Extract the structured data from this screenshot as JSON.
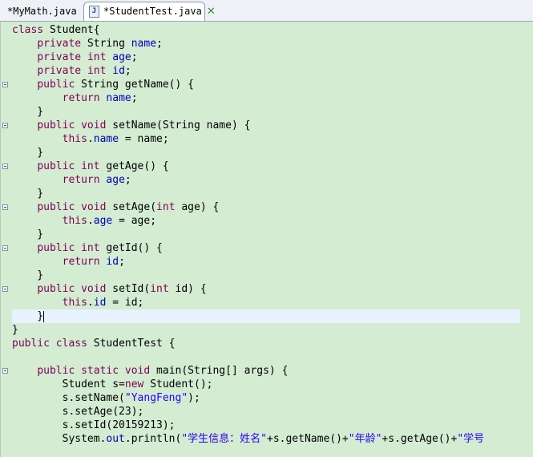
{
  "tabs": [
    {
      "label": "*MyMath.java",
      "active": false
    },
    {
      "label": "*StudentTest.java",
      "active": true
    }
  ],
  "colors": {
    "editor_bg": "#d3ecd2",
    "keyword": "#7f0055",
    "field": "#0000c0",
    "string": "#2a00ff",
    "current_line": "#e8f2fe"
  },
  "code_lines": [
    [
      [
        "kw",
        "class"
      ],
      [
        "p",
        " Student{"
      ]
    ],
    [
      [
        "p",
        "    "
      ],
      [
        "kw",
        "private"
      ],
      [
        "p",
        " String "
      ],
      [
        "fd",
        "name"
      ],
      [
        "p",
        ";"
      ]
    ],
    [
      [
        "p",
        "    "
      ],
      [
        "kw",
        "private"
      ],
      [
        "p",
        " "
      ],
      [
        "kw",
        "int"
      ],
      [
        "p",
        " "
      ],
      [
        "fd",
        "age"
      ],
      [
        "p",
        ";"
      ]
    ],
    [
      [
        "p",
        "    "
      ],
      [
        "kw",
        "private"
      ],
      [
        "p",
        " "
      ],
      [
        "kw",
        "int"
      ],
      [
        "p",
        " "
      ],
      [
        "fd",
        "id"
      ],
      [
        "p",
        ";"
      ]
    ],
    [
      [
        "p",
        "    "
      ],
      [
        "kw",
        "public"
      ],
      [
        "p",
        " String getName() {"
      ]
    ],
    [
      [
        "p",
        "        "
      ],
      [
        "kw",
        "return"
      ],
      [
        "p",
        " "
      ],
      [
        "fd",
        "name"
      ],
      [
        "p",
        ";"
      ]
    ],
    [
      [
        "p",
        "    }"
      ]
    ],
    [
      [
        "p",
        "    "
      ],
      [
        "kw",
        "public"
      ],
      [
        "p",
        " "
      ],
      [
        "kw",
        "void"
      ],
      [
        "p",
        " setName(String name) {"
      ]
    ],
    [
      [
        "p",
        "        "
      ],
      [
        "kw",
        "this"
      ],
      [
        "p",
        "."
      ],
      [
        "fd",
        "name"
      ],
      [
        "p",
        " = name;"
      ]
    ],
    [
      [
        "p",
        "    }"
      ]
    ],
    [
      [
        "p",
        "    "
      ],
      [
        "kw",
        "public"
      ],
      [
        "p",
        " "
      ],
      [
        "kw",
        "int"
      ],
      [
        "p",
        " getAge() {"
      ]
    ],
    [
      [
        "p",
        "        "
      ],
      [
        "kw",
        "return"
      ],
      [
        "p",
        " "
      ],
      [
        "fd",
        "age"
      ],
      [
        "p",
        ";"
      ]
    ],
    [
      [
        "p",
        "    }"
      ]
    ],
    [
      [
        "p",
        "    "
      ],
      [
        "kw",
        "public"
      ],
      [
        "p",
        " "
      ],
      [
        "kw",
        "void"
      ],
      [
        "p",
        " setAge("
      ],
      [
        "kw",
        "int"
      ],
      [
        "p",
        " age) {"
      ]
    ],
    [
      [
        "p",
        "        "
      ],
      [
        "kw",
        "this"
      ],
      [
        "p",
        "."
      ],
      [
        "fd",
        "age"
      ],
      [
        "p",
        " = age;"
      ]
    ],
    [
      [
        "p",
        "    }"
      ]
    ],
    [
      [
        "p",
        "    "
      ],
      [
        "kw",
        "public"
      ],
      [
        "p",
        " "
      ],
      [
        "kw",
        "int"
      ],
      [
        "p",
        " getId() {"
      ]
    ],
    [
      [
        "p",
        "        "
      ],
      [
        "kw",
        "return"
      ],
      [
        "p",
        " "
      ],
      [
        "fd",
        "id"
      ],
      [
        "p",
        ";"
      ]
    ],
    [
      [
        "p",
        "    }"
      ]
    ],
    [
      [
        "p",
        "    "
      ],
      [
        "kw",
        "public"
      ],
      [
        "p",
        " "
      ],
      [
        "kw",
        "void"
      ],
      [
        "p",
        " setId("
      ],
      [
        "kw",
        "int"
      ],
      [
        "p",
        " id) {"
      ]
    ],
    [
      [
        "p",
        "        "
      ],
      [
        "kw",
        "this"
      ],
      [
        "p",
        "."
      ],
      [
        "fd",
        "id"
      ],
      [
        "p",
        " = id;"
      ]
    ],
    [
      [
        "p",
        "    }"
      ]
    ],
    [
      [
        "p",
        "}"
      ]
    ],
    [
      [
        "kw",
        "public"
      ],
      [
        "p",
        " "
      ],
      [
        "kw",
        "class"
      ],
      [
        "p",
        " StudentTest {"
      ]
    ],
    [
      [
        "p",
        ""
      ]
    ],
    [
      [
        "p",
        "    "
      ],
      [
        "kw",
        "public"
      ],
      [
        "p",
        " "
      ],
      [
        "kw",
        "static"
      ],
      [
        "p",
        " "
      ],
      [
        "kw",
        "void"
      ],
      [
        "p",
        " main(String[] args) {"
      ]
    ],
    [
      [
        "p",
        "        Student s="
      ],
      [
        "kw",
        "new"
      ],
      [
        "p",
        " Student();"
      ]
    ],
    [
      [
        "p",
        "        s.setName("
      ],
      [
        "st",
        "\"YangFeng\""
      ],
      [
        "p",
        ");"
      ]
    ],
    [
      [
        "p",
        "        s.setAge(23);"
      ]
    ],
    [
      [
        "p",
        "        s.setId(20159213);"
      ]
    ],
    [
      [
        "p",
        "        System."
      ],
      [
        "fd",
        "out"
      ],
      [
        "p",
        ".println("
      ],
      [
        "st",
        "\"学生信息：姓名\""
      ],
      [
        "p",
        "+s.getName()+"
      ],
      [
        "st",
        "\"年龄\""
      ],
      [
        "p",
        "+s.getAge()+"
      ],
      [
        "st",
        "\"学号"
      ]
    ]
  ],
  "fold_lines": [
    4,
    7,
    10,
    13,
    16,
    19,
    25
  ],
  "current_line": 21
}
